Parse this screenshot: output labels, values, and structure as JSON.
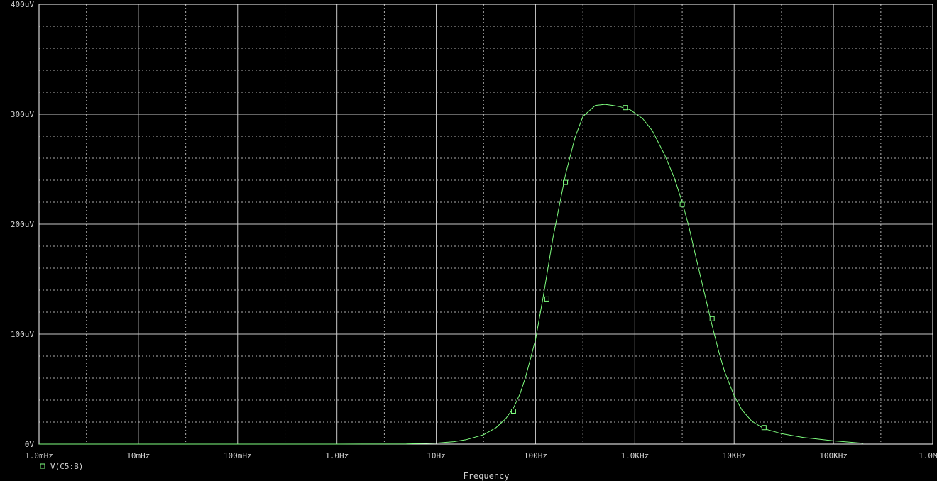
{
  "chart_data": {
    "type": "line",
    "title": "",
    "xlabel": "Frequency",
    "ylabel": "",
    "x_scale": "log",
    "xlim": [
      0.001,
      1000000
    ],
    "ylim": [
      0,
      400
    ],
    "y_unit": "uV",
    "x_ticks": [
      {
        "value": 0.001,
        "label": "1.0mHz"
      },
      {
        "value": 0.01,
        "label": "10mHz"
      },
      {
        "value": 0.1,
        "label": "100mHz"
      },
      {
        "value": 1,
        "label": "1.0Hz"
      },
      {
        "value": 10,
        "label": "10Hz"
      },
      {
        "value": 100,
        "label": "100Hz"
      },
      {
        "value": 1000,
        "label": "1.0KHz"
      },
      {
        "value": 10000,
        "label": "10KHz"
      },
      {
        "value": 100000,
        "label": "100KHz"
      },
      {
        "value": 1000000,
        "label": "1.0MHz"
      }
    ],
    "y_ticks": [
      {
        "value": 0,
        "label": "0V"
      },
      {
        "value": 100,
        "label": "100uV"
      },
      {
        "value": 200,
        "label": "200uV"
      },
      {
        "value": 300,
        "label": "300uV"
      },
      {
        "value": 400,
        "label": "400uV"
      }
    ],
    "grid": true,
    "legend_position": "bottom-left",
    "series": [
      {
        "name": "V(C5:B)",
        "color": "#7fff7f",
        "marker": "square",
        "x": [
          0.001,
          1,
          5,
          10,
          15,
          20,
          30,
          40,
          50,
          60,
          70,
          80,
          100,
          120,
          150,
          200,
          250,
          300,
          400,
          500,
          600,
          700,
          900,
          1200,
          1500,
          2000,
          2500,
          3000,
          3500,
          4000,
          5000,
          6000,
          7000,
          8000,
          10000,
          12000,
          15000,
          20000,
          30000,
          50000,
          100000,
          200000
        ],
        "values": [
          0,
          0,
          0.2,
          0.9,
          2.2,
          4,
          8.5,
          15,
          23,
          33,
          46,
          62,
          95,
          135,
          188,
          245,
          279,
          298,
          308,
          309,
          308,
          307,
          304,
          296,
          285,
          263,
          242,
          220,
          198,
          175,
          138,
          108,
          84,
          66,
          44,
          31,
          21,
          14,
          9.5,
          6,
          3,
          0.7
        ]
      }
    ],
    "markers": {
      "series": "V(C5:B)",
      "x": [
        60,
        130,
        200,
        800,
        3000,
        6000,
        20000
      ],
      "values": [
        30,
        132,
        238,
        306,
        218,
        114,
        15
      ]
    }
  }
}
